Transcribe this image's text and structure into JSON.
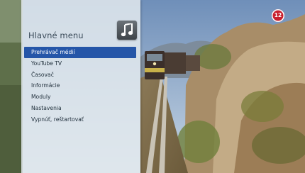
{
  "menu": {
    "title": "Hlavné menu",
    "items": [
      {
        "label": "Prehrávač médií",
        "active": true
      },
      {
        "label": "YouTube TV",
        "active": false
      },
      {
        "label": "Časovač",
        "active": false
      },
      {
        "label": "Informácie",
        "active": false
      },
      {
        "label": "Moduly",
        "active": false
      },
      {
        "label": "Nastavenia",
        "active": false
      },
      {
        "label": "Vypnúť, reštartovať",
        "active": false
      }
    ],
    "selected_icon": "music-note-icon"
  },
  "age_rating": "12",
  "colors": {
    "highlight": "#2556a8",
    "badge": "#c8202e"
  }
}
